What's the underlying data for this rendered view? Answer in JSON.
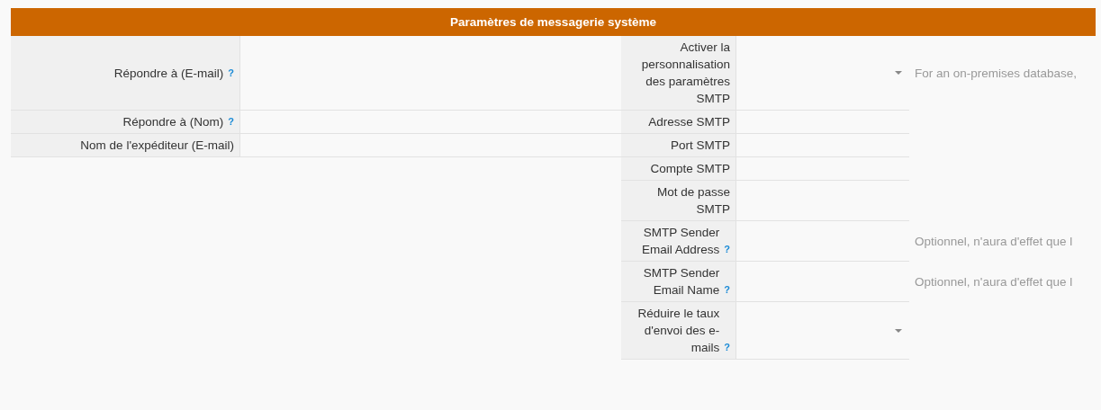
{
  "header": {
    "title": "Paramètres de messagerie système"
  },
  "left_fields": [
    {
      "label": "Répondre à (E-mail)",
      "help": "?",
      "kind": "text"
    },
    {
      "label": "Répondre à (Nom)",
      "help": "?",
      "kind": "text"
    },
    {
      "label": "Nom de l'expéditeur (E-mail)",
      "kind": "text"
    }
  ],
  "right_fields": [
    {
      "label": "Activer la personnalisation des paramètres SMTP",
      "kind": "select",
      "hint": "For an on-premises database,"
    },
    {
      "label": "Adresse SMTP",
      "kind": "text"
    },
    {
      "label": "Port SMTP",
      "kind": "text"
    },
    {
      "label": "Compte SMTP",
      "kind": "text"
    },
    {
      "label": "Mot de passe SMTP",
      "kind": "text"
    },
    {
      "label": "SMTP Sender Email Address",
      "help": "?",
      "kind": "text",
      "hint": "Optionnel, n'aura d'effet que l"
    },
    {
      "label": "SMTP Sender Email Name",
      "help": "?",
      "kind": "text",
      "hint": "Optionnel, n'aura d'effet que l"
    },
    {
      "label": "Réduire le taux d'envoi des e-mails",
      "help": "?",
      "kind": "select"
    }
  ]
}
